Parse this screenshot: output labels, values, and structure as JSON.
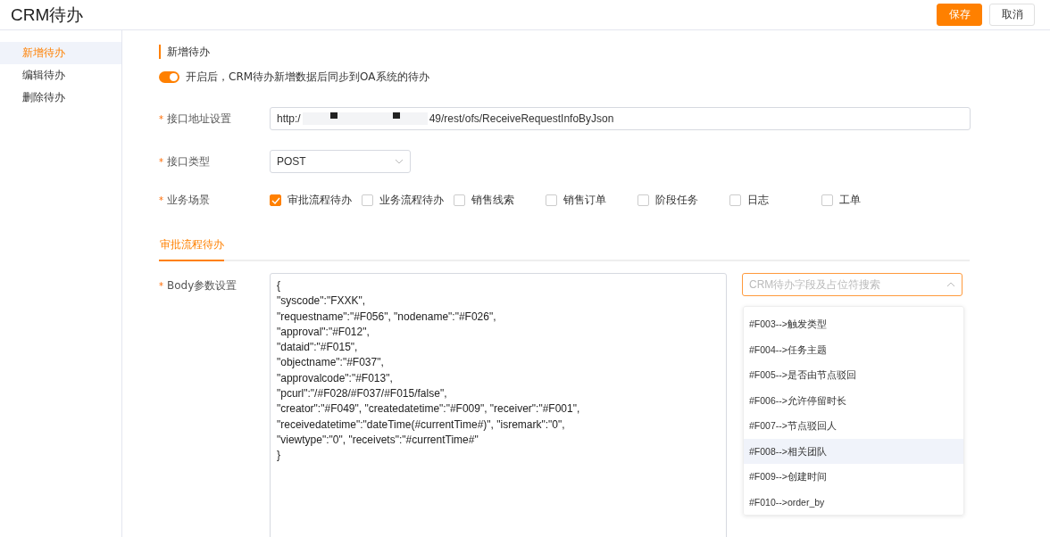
{
  "header": {
    "title": "CRM待办",
    "buttons": [
      {
        "label": "保存",
        "kind": "primary"
      },
      {
        "label": "取消",
        "kind": "default"
      }
    ]
  },
  "sidebar": {
    "items": [
      {
        "label": "新增待办",
        "selected": true
      },
      {
        "label": "编辑待办",
        "selected": false
      },
      {
        "label": "删除待办",
        "selected": false
      }
    ]
  },
  "section": {
    "title": "新增待办"
  },
  "sync_toggle": {
    "on": true,
    "label": "开启后，CRM待办新增数据后同步到OA系统的待办"
  },
  "url_field": {
    "label": "接口地址设置",
    "required_mark": "*",
    "value_start": "http:/",
    "value_end": "49/rest/ofs/ReceiveRequestInfoByJson"
  },
  "type_field": {
    "label": "接口类型",
    "required_mark": "*",
    "value": "POST"
  },
  "scenes": {
    "label": "业务场景",
    "required_mark": "*",
    "options": [
      {
        "label": "审批流程待办",
        "checked": true
      },
      {
        "label": "业务流程待办",
        "checked": false
      },
      {
        "label": "销售线索",
        "checked": false
      },
      {
        "label": "销售订单",
        "checked": false
      },
      {
        "label": "阶段任务",
        "checked": false
      },
      {
        "label": "日志",
        "checked": false
      },
      {
        "label": "工单",
        "checked": false
      }
    ]
  },
  "tabs": [
    {
      "label": "审批流程待办",
      "selected": true
    }
  ],
  "body_field": {
    "label": "Body参数设置",
    "required_mark": "*",
    "lines": [
      "{",
      "\"syscode\":\"FXXK\",",
      "\"requestname\":\"#F056\", \"nodename\":\"#F026\",",
      "\"approval\":\"#F012\",",
      "\"dataid\":\"#F015\",",
      "\"objectname\":\"#F037\",",
      "\"approvalcode\":\"#F013\",",
      "\"pcurl\":\"/#F028/#F037/#F015/false\",",
      "\"creator\":\"#F049\", \"createdatetime\":\"#F009\", \"receiver\":\"#F001\",",
      "\"receivedatetime\":\"dateTime(#currentTime#)\", \"isremark\":\"0\",",
      "\"viewtype\":\"0\", \"receivets\":\"#currentTime#\"",
      "}"
    ]
  },
  "field_search": {
    "placeholder": "CRM待办字段及占位符搜索",
    "expanded": true,
    "options": [
      {
        "label": "#F003-->触发类型",
        "hovered": false
      },
      {
        "label": "#F004-->任务主题",
        "hovered": false
      },
      {
        "label": "#F005-->是否由节点驳回",
        "hovered": false
      },
      {
        "label": "#F006-->允许停留时长",
        "hovered": false
      },
      {
        "label": "#F007-->节点驳回人",
        "hovered": false
      },
      {
        "label": "#F008-->相关团队",
        "hovered": true
      },
      {
        "label": "#F009-->创建时间",
        "hovered": false
      },
      {
        "label": "#F010-->order_by",
        "hovered": false
      }
    ]
  }
}
